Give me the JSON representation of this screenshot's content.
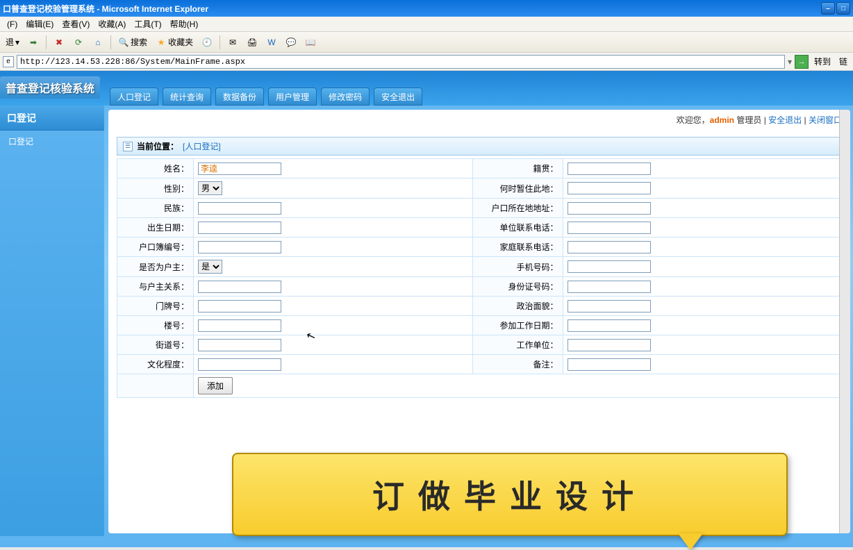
{
  "window": {
    "title": "口普查登记校验管理系统 - Microsoft Internet Explorer"
  },
  "menus": [
    "(F)",
    "编辑(E)",
    "查看(V)",
    "收藏(A)",
    "工具(T)",
    "帮助(H)"
  ],
  "toolbar": {
    "back": "退",
    "search": "搜索",
    "favorites": "收藏夹"
  },
  "address": {
    "url": "http://123.14.53.228:86/System/MainFrame.aspx",
    "go": "转到",
    "links": "链"
  },
  "app": {
    "logo": "普查登记核验系统",
    "tabs": [
      "人口登记",
      "统计查询",
      "数据备份",
      "用户管理",
      "修改密码",
      "安全退出"
    ]
  },
  "sidebar": {
    "header": "口登记",
    "items": [
      "口登记"
    ]
  },
  "welcome": {
    "greeting": "欢迎您，",
    "user": "admin",
    "role": "管理员",
    "logout": "安全退出",
    "close": "关闭窗口"
  },
  "panel": {
    "label": "当前位置：",
    "link": "[人口登记]"
  },
  "form": {
    "left": [
      {
        "label": "姓名：",
        "type": "text",
        "value": "李逵"
      },
      {
        "label": "性别：",
        "type": "select",
        "value": "男"
      },
      {
        "label": "民族：",
        "type": "text",
        "value": ""
      },
      {
        "label": "出生日期：",
        "type": "text",
        "value": ""
      },
      {
        "label": "户口簿编号：",
        "type": "text",
        "value": ""
      },
      {
        "label": "是否为户主：",
        "type": "select",
        "value": "是"
      },
      {
        "label": "与户主关系：",
        "type": "text",
        "value": ""
      },
      {
        "label": "门牌号：",
        "type": "text",
        "value": ""
      },
      {
        "label": "楼号：",
        "type": "text",
        "value": ""
      },
      {
        "label": "街道号：",
        "type": "text",
        "value": ""
      },
      {
        "label": "文化程度：",
        "type": "text",
        "value": ""
      }
    ],
    "right": [
      {
        "label": "籍贯：",
        "value": ""
      },
      {
        "label": "何时暂住此地：",
        "value": ""
      },
      {
        "label": "户口所在地地址：",
        "value": ""
      },
      {
        "label": "单位联系电话：",
        "value": ""
      },
      {
        "label": "家庭联系电话：",
        "value": ""
      },
      {
        "label": "手机号码：",
        "value": ""
      },
      {
        "label": "身份证号码：",
        "value": ""
      },
      {
        "label": "政治面貌：",
        "value": ""
      },
      {
        "label": "参加工作日期：",
        "value": ""
      },
      {
        "label": "工作单位：",
        "value": ""
      },
      {
        "label": "备注：",
        "value": ""
      }
    ],
    "submit": "添加"
  },
  "callout": "订做毕业设计"
}
